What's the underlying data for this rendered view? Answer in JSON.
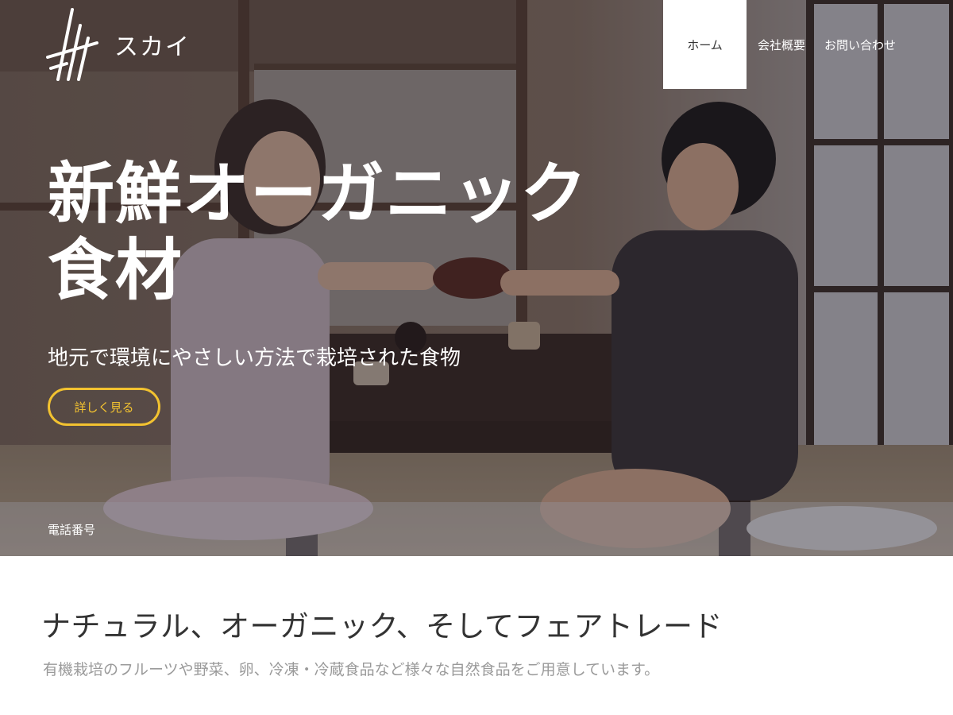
{
  "brand": {
    "name": "スカイ",
    "logo_icon": "sky-logo-icon"
  },
  "nav": {
    "items": [
      {
        "label": "ホーム",
        "active": true
      },
      {
        "label": "会社概要",
        "active": false
      },
      {
        "label": "お問い合わせ",
        "active": false
      }
    ]
  },
  "hero": {
    "title_line1": "新鮮オーガニック",
    "title_line2": "食材",
    "subtitle": "地元で環境にやさしい方法で栽培された食物",
    "cta_label": "詳しく見る",
    "phone_label": "電話番号"
  },
  "section": {
    "heading": "ナチュラル、オーガニック、そしてフェアトレード",
    "text": "有機栽培のフルーツや野菜、卵、冷凍・冷蔵食品など様々な自然食品をご用意しています。"
  },
  "colors": {
    "accent": "#f2c230",
    "heading": "#333333",
    "body_text": "#9a9a9a",
    "nav_active_bg": "#ffffff"
  }
}
